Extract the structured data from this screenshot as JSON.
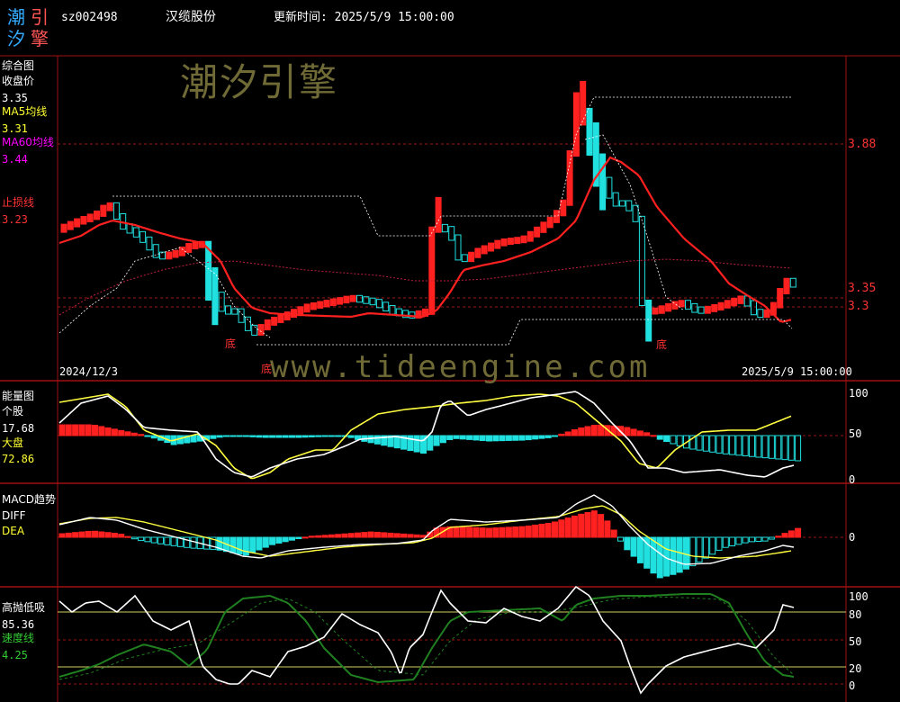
{
  "header": {
    "logo_chars": [
      "潮",
      "引",
      "汐",
      "擎"
    ],
    "code": "sz002498",
    "name": "汉缆股份",
    "update": "更新时间: 2025/5/9 15:00:00"
  },
  "watermarks": {
    "brand": "潮汐引擎",
    "url": "www.tideengine.com"
  },
  "panel1": {
    "title": "综合图",
    "close_label": "收盘价",
    "close_value": "3.35",
    "ma5_label": "MA5均线",
    "ma5_value": "3.31",
    "ma60_label": "MA60均线",
    "ma60_value": "3.44",
    "stop_label": "止损线",
    "stop_value": "3.23",
    "right_prices": [
      "3.88",
      "3.35",
      "3.3"
    ],
    "bottom_labels": [
      "底",
      "底",
      "底"
    ],
    "date_start": "2024/12/3",
    "date_end": "2025/5/9 15:00:00"
  },
  "panel2": {
    "title": "能量图",
    "stock_label": "个股",
    "stock_value": "17.68",
    "market_label": "大盘",
    "market_value": "72.86",
    "axis": [
      "100",
      "50",
      "0"
    ]
  },
  "panel3": {
    "title": "MACD趋势",
    "diff_label": "DIFF",
    "dea_label": "DEA",
    "axis": [
      "0"
    ]
  },
  "panel4": {
    "title": "高抛低吸",
    "value": "85.36",
    "speed_label": "速度线",
    "speed_value": "4.25",
    "axis": [
      "100",
      "80",
      "50",
      "20",
      "0"
    ]
  },
  "colors": {
    "up": "#ff2020",
    "down": "#20e0e0",
    "ma5": "#ff2020",
    "ma60": "#c02040",
    "yellow": "#ffff40",
    "green": "#208020",
    "grid": "#a01010"
  }
}
